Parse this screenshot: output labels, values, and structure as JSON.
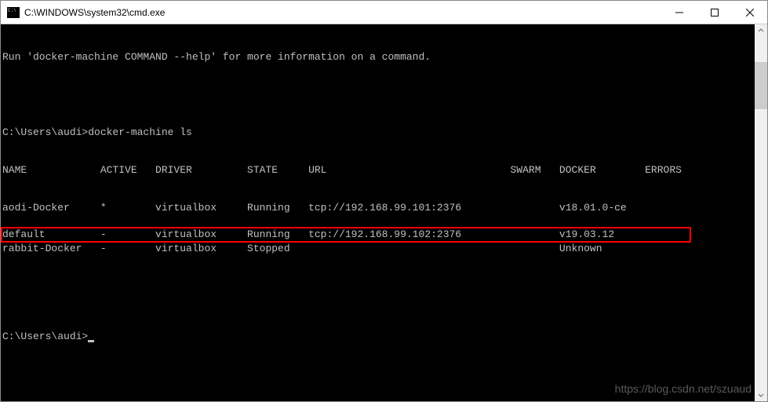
{
  "window": {
    "title": "C:\\WINDOWS\\system32\\cmd.exe"
  },
  "terminal": {
    "help_line": "Run 'docker-machine COMMAND --help' for more information on a command.",
    "prompt1": "C:\\Users\\audi>",
    "command1": "docker-machine ls",
    "header": {
      "name": "NAME",
      "active": "ACTIVE",
      "driver": "DRIVER",
      "state": "STATE",
      "url": "URL",
      "swarm": "SWARM",
      "docker": "DOCKER",
      "errors": "ERRORS"
    },
    "rows": [
      {
        "name": "aodi-Docker",
        "active": "*",
        "driver": "virtualbox",
        "state": "Running",
        "url": "tcp://192.168.99.101:2376",
        "swarm": "",
        "docker": "v18.01.0-ce",
        "errors": "",
        "highlight": false
      },
      {
        "name": "default",
        "active": "-",
        "driver": "virtualbox",
        "state": "Running",
        "url": "tcp://192.168.99.102:2376",
        "swarm": "",
        "docker": "v19.03.12",
        "errors": "",
        "highlight": true
      },
      {
        "name": "rabbit-Docker",
        "active": "-",
        "driver": "virtualbox",
        "state": "Stopped",
        "url": "",
        "swarm": "",
        "docker": "Unknown",
        "errors": "",
        "highlight": false
      }
    ],
    "prompt2": "C:\\Users\\audi>"
  },
  "watermark": "https://blog.csdn.net/szuaud"
}
